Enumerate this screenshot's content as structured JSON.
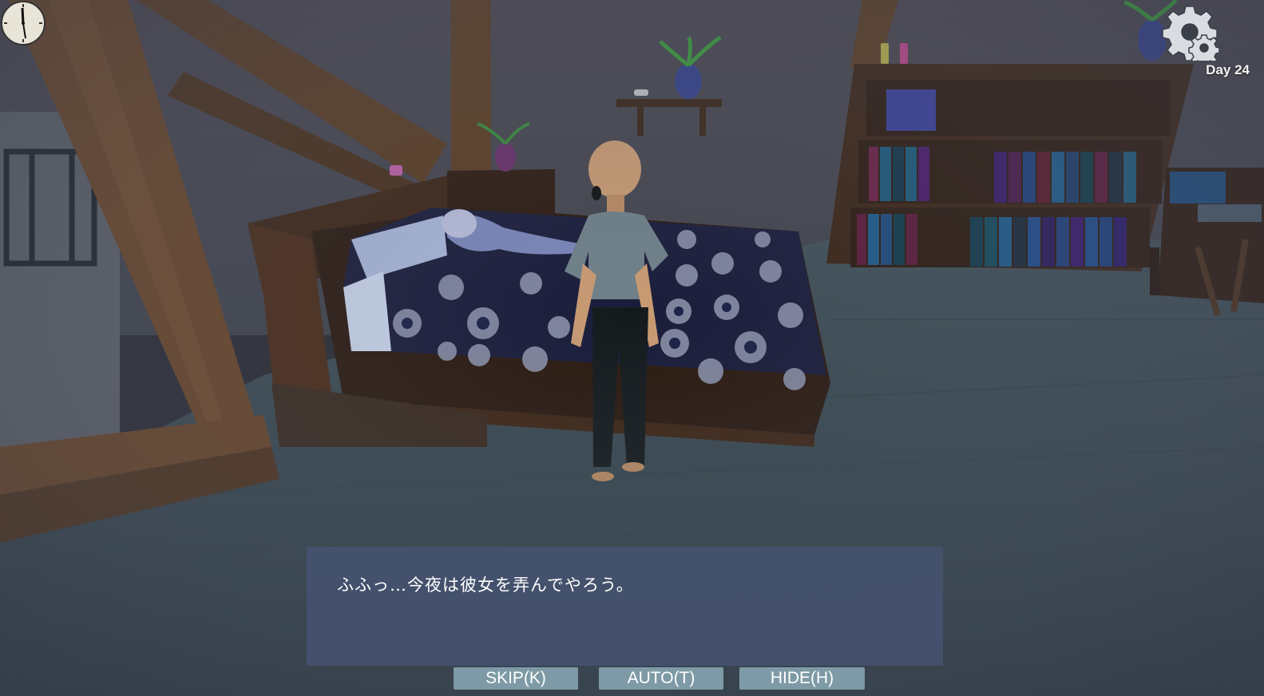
{
  "hud": {
    "day_label": "Day 24",
    "settings_icon": "gear-icon",
    "clock_icon": "analog-clock-icon"
  },
  "dialogue": {
    "text": "ふふっ…今夜は彼女を弄んでやろう。"
  },
  "controls": {
    "skip_label": "SKIP(K)",
    "auto_label": "AUTO(T)",
    "hide_label": "HIDE(H)"
  },
  "colors": {
    "dialogue_bg": "#465270",
    "button_bg": "#7e9aa6",
    "wall": "#4a4850",
    "floor": "#3a4a52"
  }
}
